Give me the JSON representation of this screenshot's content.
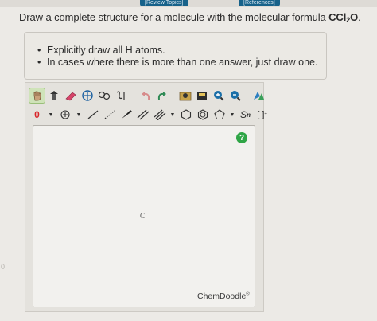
{
  "header": {
    "review_topics": "[Review Topics]",
    "references": "[References]"
  },
  "question": {
    "prefix": "Draw a complete structure for a molecule with the molecular formula ",
    "formula_main": "CCl",
    "formula_sub": "2",
    "formula_end": "O",
    "period": "."
  },
  "instructions": [
    "Explicitly draw all H atoms.",
    "In cases where there is more than one answer, just draw one."
  ],
  "toolbar": {
    "charge_value": "0",
    "brackets_label": "[ ]",
    "sn_label": "n",
    "sn_prefix": "S",
    "superscript_label": "±"
  },
  "canvas": {
    "atom_label": "C",
    "help_label": "?",
    "brand": "ChemDoodle",
    "brand_mark": "®"
  },
  "colors": {
    "link_bar": "#17628a",
    "help_button": "#2fa546",
    "charge_red": "#d9262a"
  },
  "icons": {
    "row1": [
      "hand-icon",
      "erase-atom-icon",
      "eraser-icon",
      "lasso-select-icon",
      "rotate-3d-icon",
      "flip-icon",
      "undo-icon",
      "redo-icon",
      "templates-icon",
      "open-file-icon",
      "zoom-in-icon",
      "zoom-out-icon",
      "clean-icon"
    ],
    "row2": [
      "charge-icon",
      "add-lone-pair-icon",
      "single-bond-icon",
      "dashed-bond-icon",
      "wedge-bond-icon",
      "double-bond-icon",
      "triple-bond-icon",
      "cyclohexane-icon",
      "benzene-icon",
      "cyclopentane-icon",
      "sn-repeat-icon",
      "bracket-icon"
    ]
  }
}
